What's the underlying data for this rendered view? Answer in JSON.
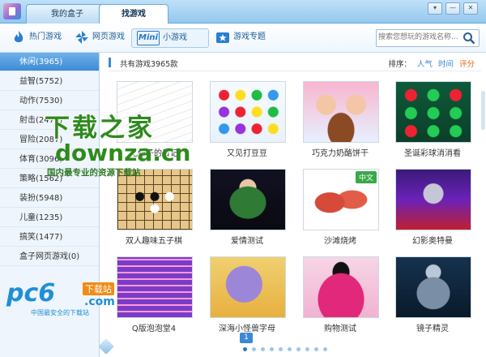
{
  "tabs": [
    {
      "label": "我的盒子",
      "active": false
    },
    {
      "label": "找游戏",
      "active": true
    }
  ],
  "window_controls": [
    "▾",
    "—",
    "✕"
  ],
  "toolbar": {
    "categories": [
      {
        "label": "热门游戏",
        "icon": "flame-icon"
      },
      {
        "label": "网页游戏",
        "icon": "pinwheel-icon"
      },
      {
        "label": "小游戏",
        "icon": "mini-icon",
        "badge": "Mini",
        "active": true
      },
      {
        "label": "游戏专题",
        "icon": "star-box-icon"
      }
    ],
    "search_placeholder": "搜索您想玩的游戏名称..."
  },
  "sidebar": {
    "items": [
      {
        "label": "休闲(3965)",
        "active": true
      },
      {
        "label": "益智(5752)"
      },
      {
        "label": "动作(7530)"
      },
      {
        "label": "射击(2476)"
      },
      {
        "label": "冒险(2087)"
      },
      {
        "label": "体育(3096)"
      },
      {
        "label": "策略(1562)"
      },
      {
        "label": "装扮(5948)"
      },
      {
        "label": "儿童(1235)"
      },
      {
        "label": "搞笑(1477)"
      },
      {
        "label": "盒子网页游戏(0)"
      }
    ]
  },
  "main": {
    "count_text": "共有游戏3965款",
    "sort_label": "排序：",
    "sort_options": [
      {
        "label": "人气",
        "selected": false
      },
      {
        "label": "时间",
        "selected": false
      },
      {
        "label": "评分",
        "selected": false
      }
    ],
    "games": [
      {
        "name": "花仙子的日记",
        "thumb": "t1"
      },
      {
        "name": "又见打豆豆",
        "thumb": "t2"
      },
      {
        "name": "巧克力奶酪饼干",
        "thumb": "t3"
      },
      {
        "name": "圣诞彩球消消看",
        "thumb": "t4"
      },
      {
        "name": "双人趣味五子棋",
        "thumb": "t5"
      },
      {
        "name": "爱情测试",
        "thumb": "t6"
      },
      {
        "name": "沙滩烧烤",
        "thumb": "t7",
        "badge": "中文"
      },
      {
        "name": "幻影奥特曼",
        "thumb": "t8"
      },
      {
        "name": "Q版泡泡堂4",
        "thumb": "t9"
      },
      {
        "name": "深海小怪兽字母",
        "thumb": "t10"
      },
      {
        "name": "购物测试",
        "thumb": "t11"
      },
      {
        "name": "镜子精灵",
        "thumb": "t12"
      }
    ]
  },
  "pager": {
    "current": "1",
    "dot_count": 10,
    "active_dot": 0
  },
  "watermarks": {
    "downza_cn": "下载之家",
    "downza_en": "downza.cn",
    "downza_sub": "国内最专业的资源下载站",
    "pc6_logo": "pc6",
    "pc6_tag": "下载站",
    "pc6_com": ".com",
    "pc6_sub": "中国最安全的下载站"
  },
  "colors": {
    "accent": "#3b88d4",
    "sort_highlight": "#e06b1c",
    "watermark_green": "#2f8a1e",
    "pc6_blue": "#1f8fd6"
  }
}
